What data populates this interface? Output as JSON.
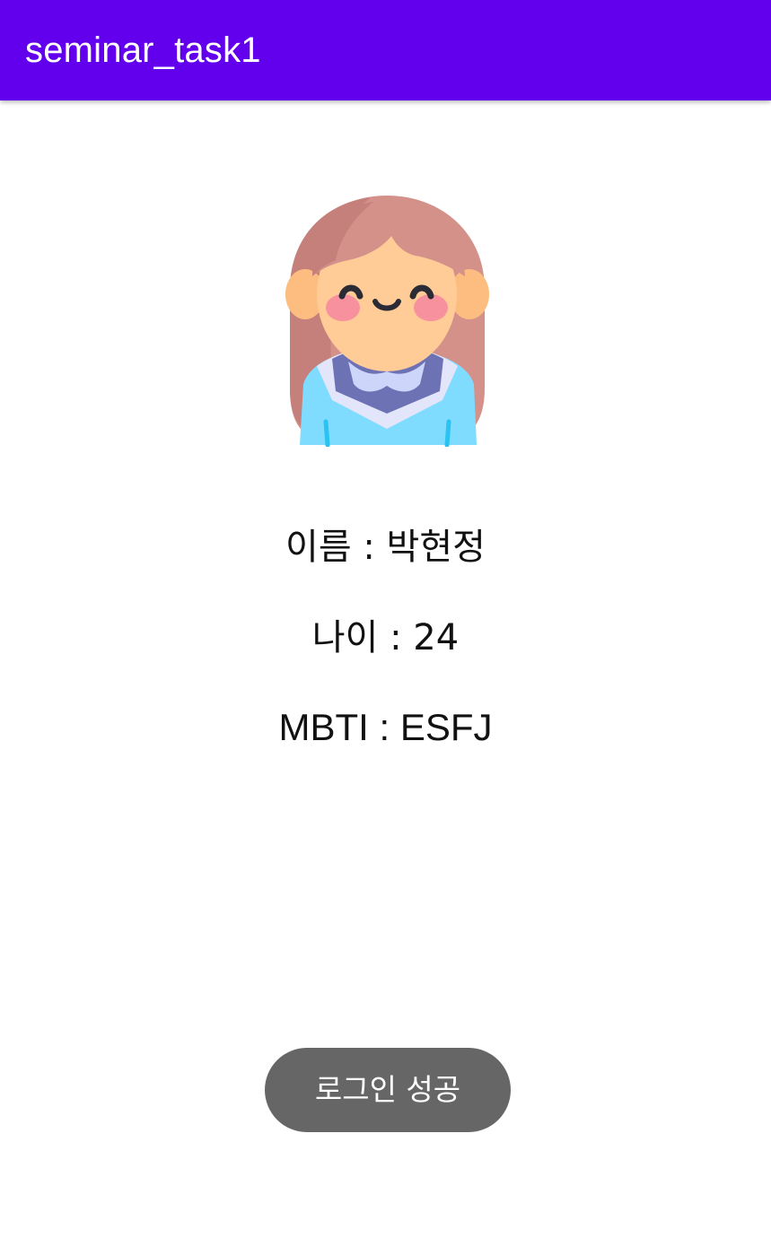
{
  "appbar": {
    "title": "seminar_task1",
    "color": "#6200ee"
  },
  "profile": {
    "avatar_icon": "girl-avatar-icon",
    "name_line": "이름 : 박현정",
    "age_line": "나이 : 24",
    "mbti_line": "MBTI : ESFJ"
  },
  "toast": {
    "message": "로그인 성공",
    "color": "#666666"
  }
}
